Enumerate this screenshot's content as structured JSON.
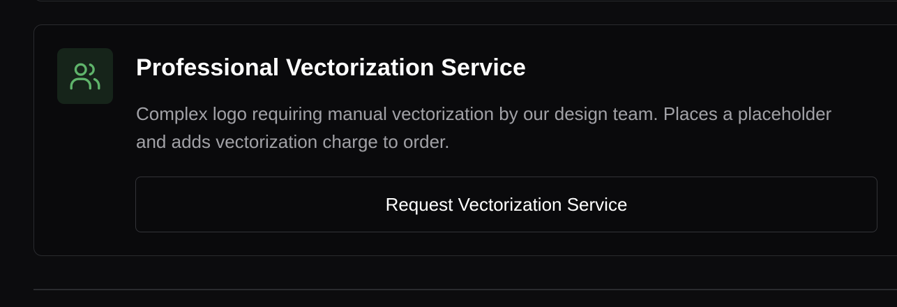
{
  "service": {
    "title": "Professional Vectorization Service",
    "description": "Complex logo requiring manual vectorization by our design team. Places a placeholder and adds vectorization charge to order.",
    "button_label": "Request Vectorization Service",
    "icon": "users-icon"
  },
  "colors": {
    "background": "#0c0c0e",
    "card_border": "#2a2b2e",
    "icon_tile": "#16241a",
    "icon_stroke": "#5fb46b",
    "title": "#ffffff",
    "description": "#a1a1a6"
  }
}
